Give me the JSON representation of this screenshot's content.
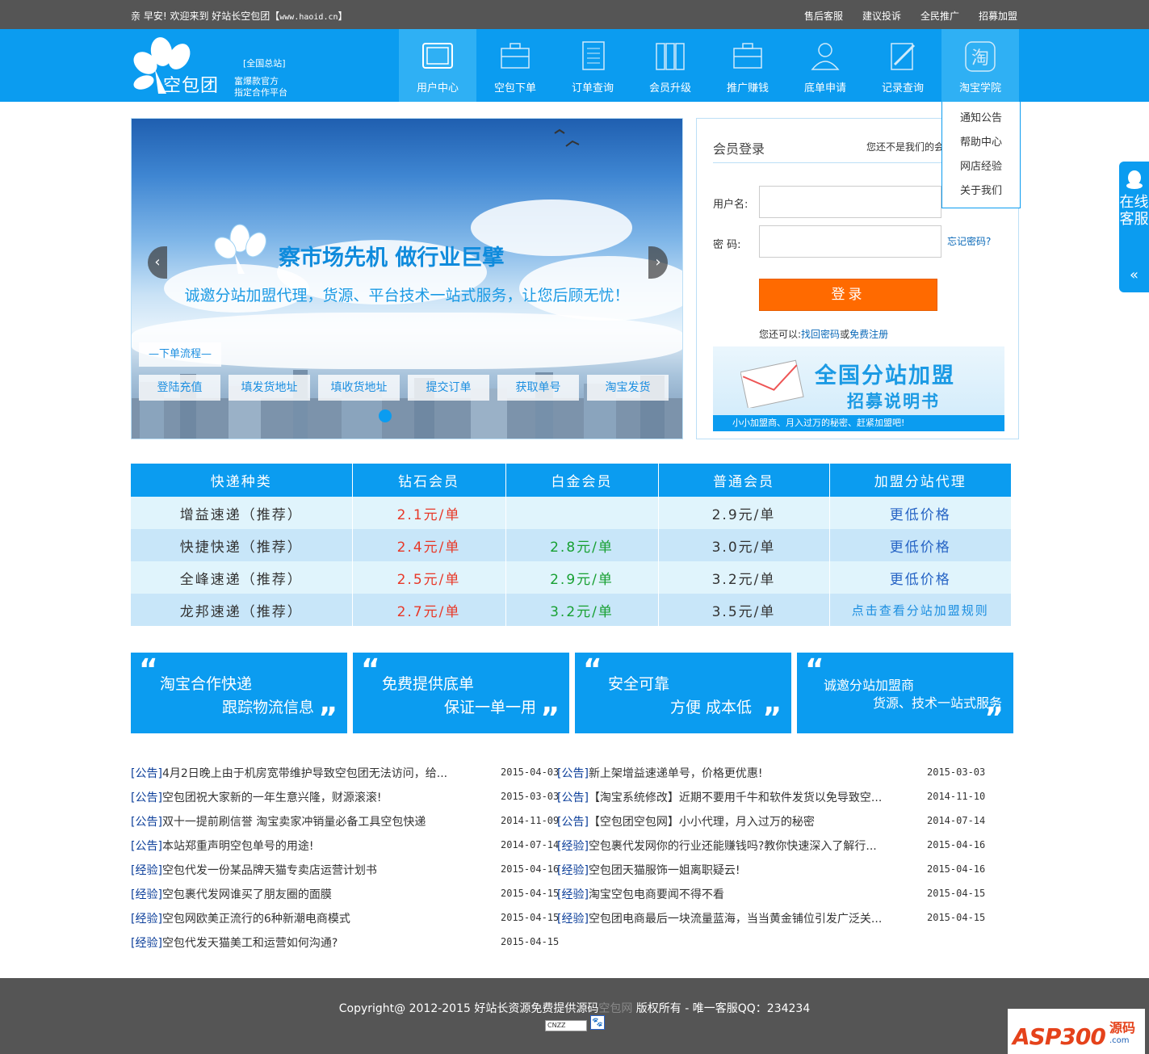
{
  "topbar": {
    "greeting": "亲 早安!  欢迎来到  好站长空包团【",
    "site_url": "www.haoid.cn",
    "greeting_end": "】",
    "links": [
      "售后客服",
      "建议投诉",
      "全民推广",
      "招募加盟"
    ]
  },
  "header": {
    "brand": "空包团",
    "station": "[全国总站]",
    "tagline_1": "富爆款官方",
    "tagline_2": "指定合作平台",
    "nav": [
      {
        "label": "用户中心",
        "icon": "tablet-icon",
        "active": true
      },
      {
        "label": "空包下单",
        "icon": "briefcase-icon"
      },
      {
        "label": "订单查询",
        "icon": "document-list-icon"
      },
      {
        "label": "会员升级",
        "icon": "books-icon"
      },
      {
        "label": "推广赚钱",
        "icon": "briefcase-icon"
      },
      {
        "label": "底单申请",
        "icon": "user-icon"
      },
      {
        "label": "记录查询",
        "icon": "edit-icon"
      },
      {
        "label": "淘宝学院",
        "icon": "taobao-icon",
        "hover": true
      }
    ],
    "dropdown": [
      "通知公告",
      "帮助中心",
      "网店经验",
      "关于我们"
    ]
  },
  "banner": {
    "slogan": "察市场先机 做行业巨擘",
    "sub": "诚邀分站加盟代理，货源、平台技术一站式服务，让您后顾无忧！",
    "flow_label": "—下单流程—",
    "steps": [
      "登陆充值",
      "填发货地址",
      "填收货地址",
      "提交订单",
      "获取单号",
      "淘宝发货"
    ],
    "prev": "‹",
    "next": "›"
  },
  "login": {
    "title": "会员登录",
    "not_member": "您还不是我们的会员",
    "username_label": "用户名:",
    "password_label": "密  码:",
    "forgot": "忘记密码?",
    "submit": "登录",
    "also_prefix": "您还可以:",
    "find_password": "找回密码",
    "or": "或",
    "register": "免费注册",
    "ad_title": "全国分站加盟",
    "ad_subtitle": "招募说明书",
    "ad_bar": "小小加盟商、月入过万的秘密、赶紧加盟吧!"
  },
  "pricing": {
    "headers": [
      "快递种类",
      "钻石会员",
      "白金会员",
      "普通会员",
      "加盟分站代理"
    ],
    "rows": [
      {
        "name": "增益速递（推荐）",
        "diamond": "2.1元/单",
        "platinum": "",
        "normal": "2.9元/单",
        "agent": "更低价格"
      },
      {
        "name": "快捷快递（推荐）",
        "diamond": "2.4元/单",
        "platinum": "2.8元/单",
        "normal": "3.0元/单",
        "agent": "更低价格"
      },
      {
        "name": "全峰速递（推荐）",
        "diamond": "2.5元/单",
        "platinum": "2.9元/单",
        "normal": "3.2元/单",
        "agent": "更低价格"
      },
      {
        "name": "龙邦速递（推荐）",
        "diamond": "2.7元/单",
        "platinum": "3.2元/单",
        "normal": "3.5元/单",
        "agent": "点击查看分站加盟规则"
      }
    ]
  },
  "features": [
    {
      "line1": "淘宝合作快递",
      "line2": "跟踪物流信息"
    },
    {
      "line1": "免费提供底单",
      "line2": "保证一单一用"
    },
    {
      "line1": "安全可靠",
      "line2": "方便 成本低"
    },
    {
      "line1": "诚邀分站加盟商",
      "line2": "货源、技术一站式服务"
    }
  ],
  "quote_open": "“",
  "quote_close": "”",
  "news_left": [
    {
      "tag": "[公告]",
      "title": "4月2日晚上由于机房宽带维护导致空包团无法访问，给...",
      "date": "2015-04-03"
    },
    {
      "tag": "[公告]",
      "title": "空包团祝大家新的一年生意兴隆，财源滚滚!",
      "date": "2015-03-03"
    },
    {
      "tag": "[公告]",
      "title": "双十一提前刷信誉 淘宝卖家冲销量必备工具空包快递",
      "date": "2014-11-09"
    },
    {
      "tag": "[公告]",
      "title": "本站郑重声明空包单号的用途!",
      "date": "2014-07-14"
    },
    {
      "tag": "[经验]",
      "title": "空包代发一份某品牌天猫专卖店运营计划书",
      "date": "2015-04-16"
    },
    {
      "tag": "[经验]",
      "title": "空包裹代发网谁买了朋友圈的面膜",
      "date": "2015-04-15"
    },
    {
      "tag": "[经验]",
      "title": "空包网欧美正流行的6种新潮电商模式",
      "date": "2015-04-15"
    },
    {
      "tag": "[经验]",
      "title": "空包代发天猫美工和运营如何沟通?",
      "date": "2015-04-15"
    }
  ],
  "news_right": [
    {
      "tag": "[公告]",
      "title": "新上架增益速递单号，价格更优惠!",
      "date": "2015-03-03"
    },
    {
      "tag": "[公告]",
      "title": "【淘宝系统修改】近期不要用千牛和软件发货以免导致空...",
      "date": "2014-11-10"
    },
    {
      "tag": "[公告]",
      "title": "【空包团空包网】小小代理，月入过万的秘密",
      "date": "2014-07-14"
    },
    {
      "tag": "[经验]",
      "title": "空包裹代发网你的行业还能赚钱吗?教你快速深入了解行...",
      "date": "2015-04-16"
    },
    {
      "tag": "[经验]",
      "title": "空包团天猫服饰一姐离职疑云!",
      "date": "2015-04-16"
    },
    {
      "tag": "[经验]",
      "title": "淘宝空包电商要闻不得不看",
      "date": "2015-04-15"
    },
    {
      "tag": "[经验]",
      "title": "空包团电商最后一块流量蓝海，当当黄金铺位引发广泛关...",
      "date": "2015-04-15"
    }
  ],
  "service": {
    "label": "在线客服",
    "collapse": "«"
  },
  "footer": {
    "copyright_a": "Copyright@ 2012-2015 好站长资源免费提供源码",
    "copyright_highlight": "空包网",
    "copyright_b": " 版权所有 - 唯一客服QQ：234234",
    "cnzz": "CNZZ",
    "asp_main": "ASP300",
    "asp_cn": "源码",
    "asp_url": ".com"
  },
  "colors": {
    "brand_blue": "#0b9cf0",
    "orange": "#ff6a00",
    "red_price": "#e83828",
    "green_price": "#17a032"
  }
}
